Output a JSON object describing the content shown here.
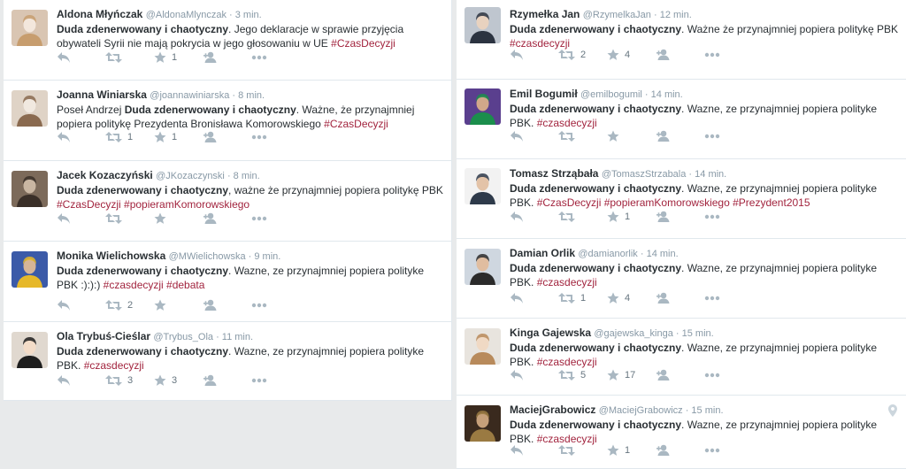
{
  "colors": {
    "hashtag": "#a2243e",
    "icon": "#aab8c2",
    "meta": "#8899a6"
  },
  "icons": {
    "reply": "reply-icon",
    "retweet": "retweet-icon",
    "favorite": "star-icon",
    "follow": "follow-icon",
    "more": "more-icon",
    "location": "location-pin-icon"
  },
  "left": {
    "tweets": [
      {
        "name": "Aldona Młyńczak",
        "handle": "@AldonaMlynczak",
        "time": "3 min.",
        "bold": "Duda zdenerwowany i chaotyczny",
        "text": ". Jego deklaracje w sprawie przyjęcia obywateli Syrii nie mają pokrycia w jego głosowaniu w UE  ",
        "tags": "#CzasDecyzji",
        "retweets": "",
        "favorites": "1"
      },
      {
        "name": "Joanna Winiarska",
        "handle": "@joannawiniarska",
        "time": "8 min.",
        "pre": "Poseł Andrzej ",
        "bold": "Duda zdenerwowany i chaotyczny",
        "text": ". Ważne, że przynajmniej popiera politykę Prezydenta Bronisława Komorowskiego ",
        "tags": "#CzasDecyzji",
        "retweets": "1",
        "favorites": "1"
      },
      {
        "name": "Jacek Kozaczyński",
        "handle": "@JKozaczynski",
        "time": "8 min.",
        "bold": "Duda zdenerwowany i chaotyczny",
        "text": ", ważne że przynajmniej popiera politykę PBK ",
        "tags": "#CzasDecyzji #popieramKomorowskiego",
        "retweets": "",
        "favorites": ""
      },
      {
        "name": "Monika Wielichowska",
        "handle": "@MWielichowska",
        "time": "9 min.",
        "bold": "Duda zdenerwowany i chaotyczny",
        "text": ". Wazne, ze przynajmniej popiera polityke PBK :):):) ",
        "tags": "#czasdecyzji #debata",
        "retweets": "2",
        "favorites": ""
      },
      {
        "name": "Ola Trybuś-Cieślar",
        "handle": "@Trybus_Ola",
        "time": "11 min.",
        "bold": "Duda zdenerwowany i chaotyczny",
        "text": ". Wazne, ze przynajmniej popiera polityke PBK. ",
        "tags": "#czasdecyzji",
        "retweets": "3",
        "favorites": "3"
      }
    ]
  },
  "right": {
    "tweets": [
      {
        "name": "Rzymełka Jan",
        "handle": "@RzymelkaJan",
        "time": "12 min.",
        "bold": "Duda zdenerwowany i chaotyczny",
        "text": ". Ważne że przynajmniej popiera politykę PBK ",
        "tags": "#czasdecyzji",
        "retweets": "2",
        "favorites": "4"
      },
      {
        "name": "Emil Bogumił",
        "handle": "@emilbogumil",
        "time": "14 min.",
        "bold": "Duda zdenerwowany i chaotyczny",
        "text": ". Wazne, ze przynajmniej popiera polityke PBK. ",
        "tags": "#czasdecyzji",
        "retweets": "",
        "favorites": ""
      },
      {
        "name": "Tomasz Strząbała",
        "handle": "@TomaszStrzabala",
        "time": "14 min.",
        "bold": "Duda zdenerwowany i chaotyczny",
        "text": ". Wazne, ze przynajmniej popiera polityke PBK. ",
        "tags": "#CzasDecyzji #popieramKomorowskiego #Prezydent2015",
        "retweets": "",
        "favorites": "1"
      },
      {
        "name": "Damian Orlik",
        "handle": "@damianorlik",
        "time": "14 min.",
        "bold": "Duda zdenerwowany i chaotyczny",
        "text": ". Wazne, ze przynajmniej popiera polityke PBK. ",
        "tags": "#czasdecyzji",
        "retweets": "1",
        "favorites": "4"
      },
      {
        "name": "Kinga Gajewska",
        "handle": "@gajewska_kinga",
        "time": "15 min.",
        "bold": "Duda zdenerwowany i chaotyczny",
        "text": ". Wazne, ze przynajmniej popiera polityke PBK. ",
        "tags": "#czasdecyzji",
        "retweets": "5",
        "favorites": "17"
      },
      {
        "name": "MaciejGrabowicz",
        "handle": "@MaciejGrabowicz",
        "time": "15 min.",
        "bold": "Duda zdenerwowany i chaotyczny",
        "text": ". Wazne, ze przynajmniej popiera polityke PBK. ",
        "tags": "#czasdecyzji",
        "retweets": "",
        "favorites": "1"
      }
    ]
  }
}
